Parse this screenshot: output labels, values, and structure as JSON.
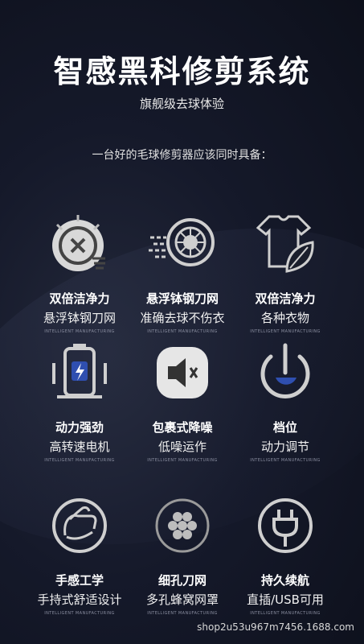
{
  "header": {
    "title": "智感黑科修剪系统",
    "subtitle": "旗舰级去球体验",
    "intro": "一台好的毛球修剪器应该同时具备："
  },
  "features": [
    {
      "title": "双倍洁净力",
      "subtitle": "悬浮钵钢刀网",
      "tag": "INTELLIGENT MANUFACTURING",
      "icon": "clock-blade-icon"
    },
    {
      "title": "悬浮钵钢刀网",
      "subtitle": "准确去球不伤衣",
      "tag": "INTELLIGENT MANUFACTURING",
      "icon": "spinning-blade-icon"
    },
    {
      "title": "双倍洁净力",
      "subtitle": "各种衣物",
      "tag": "INTELLIGENT MANUFACTURING",
      "icon": "shirt-leaf-icon"
    },
    {
      "title": "动力强劲",
      "subtitle": "高转速电机",
      "tag": "INTELLIGENT MANUFACTURING",
      "icon": "battery-motor-icon"
    },
    {
      "title": "包裹式降噪",
      "subtitle": "低噪运作",
      "tag": "INTELLIGENT MANUFACTURING",
      "icon": "mute-speaker-icon"
    },
    {
      "title": "档位",
      "subtitle": "动力调节",
      "tag": "INTELLIGENT MANUFACTURING",
      "icon": "power-icon"
    },
    {
      "title": "手感工学",
      "subtitle": "手持式舒适设计",
      "tag": "INTELLIGENT MANUFACTURING",
      "icon": "hand-grip-icon"
    },
    {
      "title": "细孔刀网",
      "subtitle": "多孔蜂窝网罩",
      "tag": "INTELLIGENT MANUFACTURING",
      "icon": "honeycomb-icon"
    },
    {
      "title": "持久续航",
      "subtitle": "直插/USB可用",
      "tag": "INTELLIGENT MANUFACTURING",
      "icon": "plug-icon"
    }
  ],
  "footer": {
    "shop": "shop2u53u967m7456.1688.com"
  }
}
